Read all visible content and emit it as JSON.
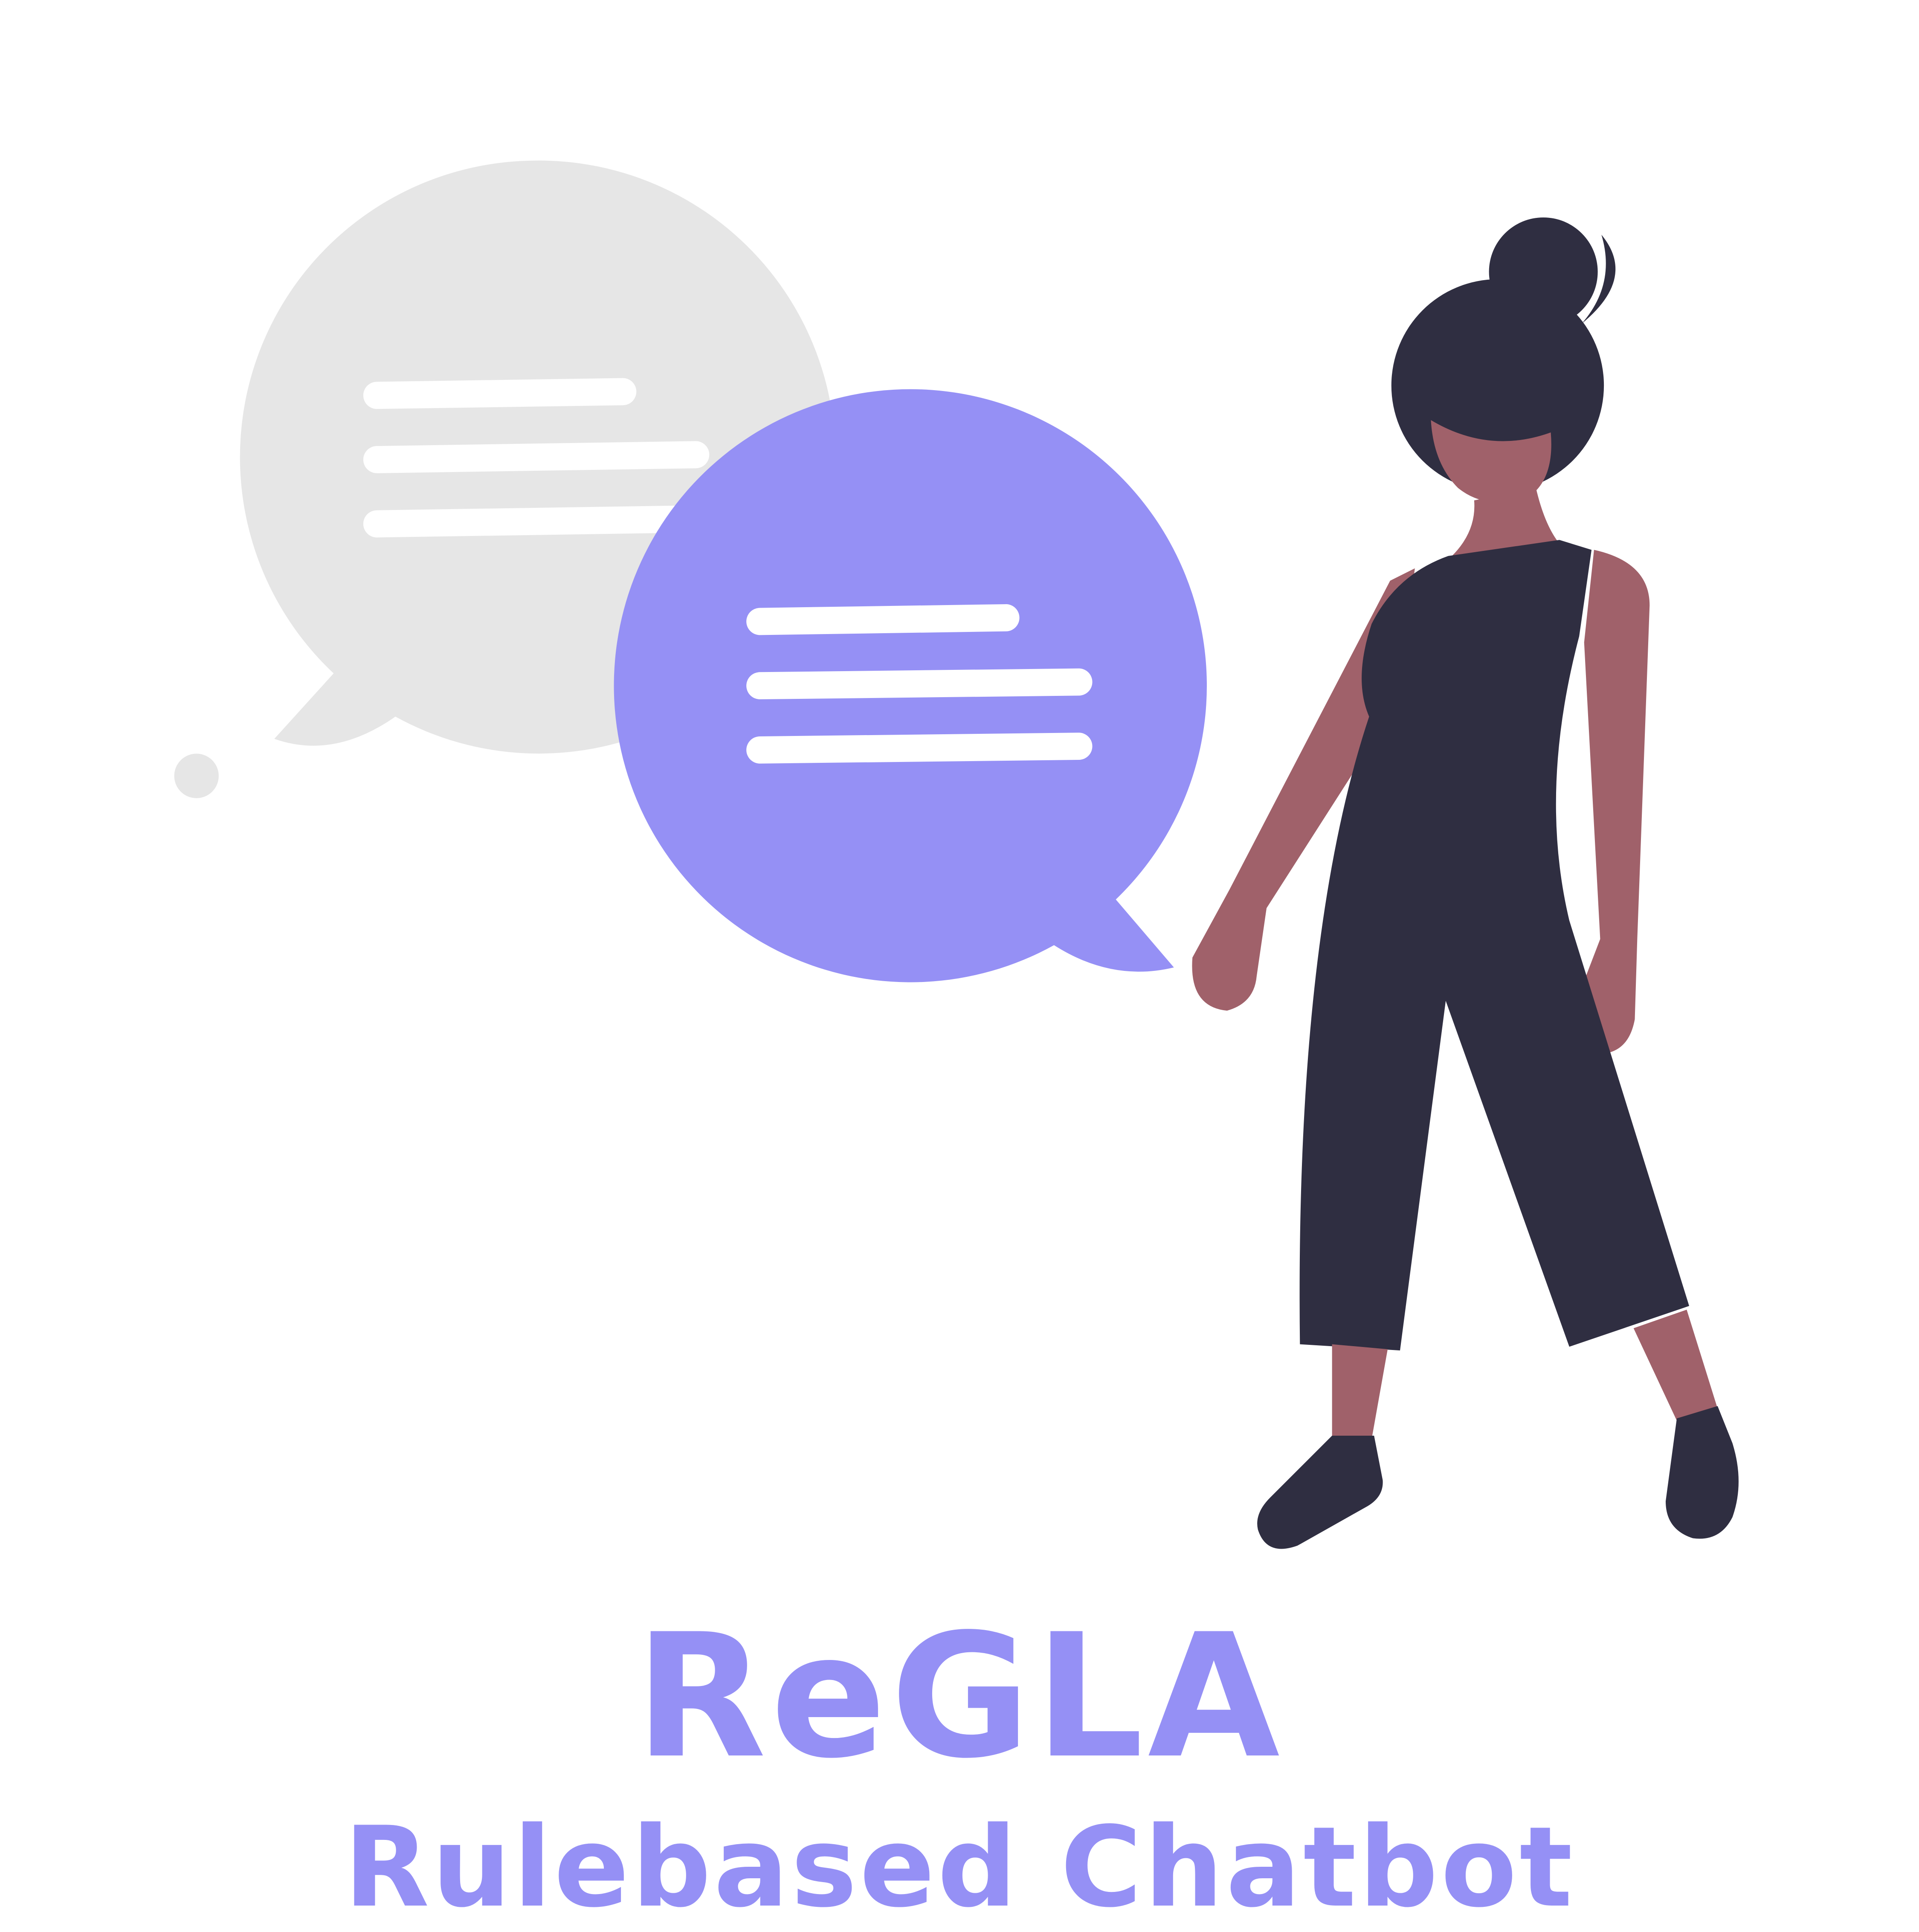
{
  "brand": {
    "title": "ReGLA",
    "subtitle": "Rulebased Chatbot"
  },
  "colors": {
    "accent": "#9590f5",
    "bubble_gray": "#e6e6e6",
    "text_lines": "#ffffff",
    "figure_dark": "#2f2e41",
    "skin": "#a0616a",
    "background": "#ffffff"
  },
  "illustration": {
    "icons": [
      "speech-bubble-gray-icon",
      "speech-bubble-purple-icon",
      "person-figure-icon"
    ]
  }
}
